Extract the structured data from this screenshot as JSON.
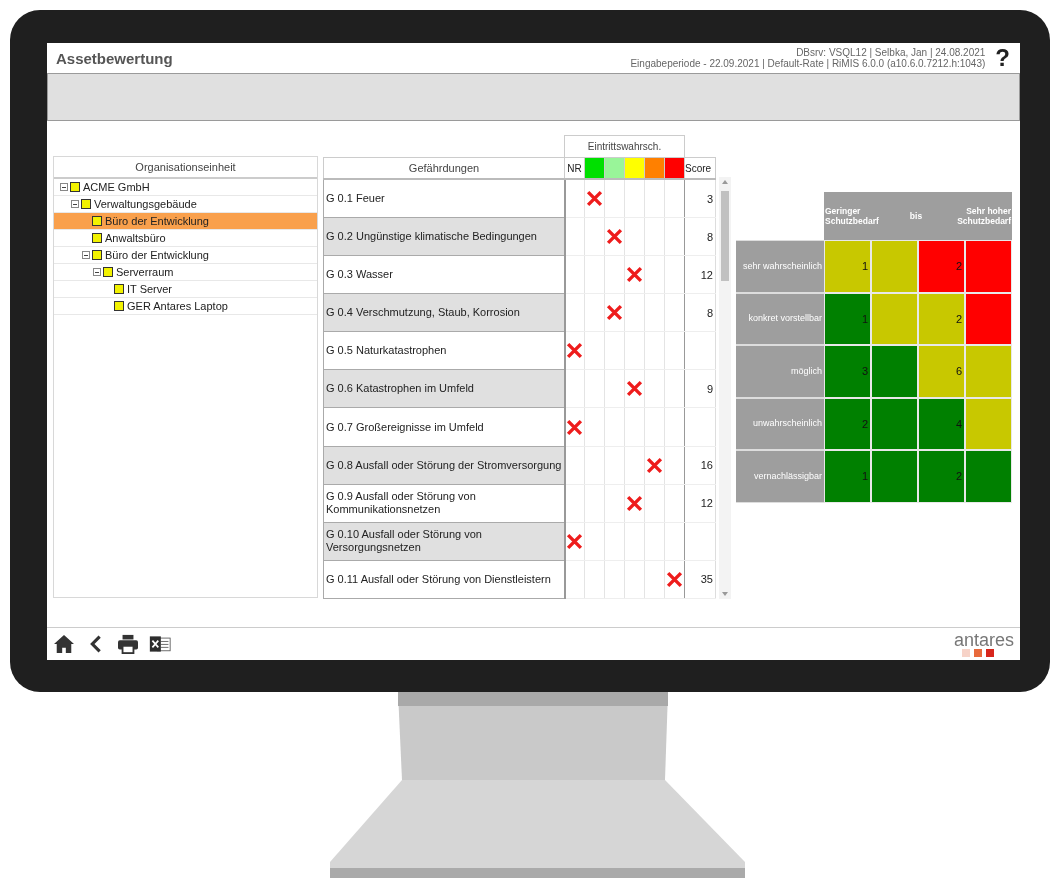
{
  "header": {
    "title": "Assetbewertung",
    "info_lines": [
      "DBsrv: VSQL12 | Selbka, Jan | 24.08.2021",
      "Eingabeperiode - 22.09.2021 | Default-Rate | RiMIS 6.0.0 (a10.6.0.7212.h:1043)"
    ],
    "help": "?"
  },
  "tree": {
    "heading": "Organisationseinheit",
    "nodes": [
      {
        "label": "ACME GmbH",
        "selected": false,
        "expanded": true,
        "children": [
          {
            "label": "Verwaltungsgebäude",
            "selected": false,
            "expanded": true,
            "children": [
              {
                "label": "Büro der Entwicklung",
                "selected": true
              },
              {
                "label": "Anwaltsbüro",
                "selected": false
              },
              {
                "label": "Büro der Entwicklung",
                "selected": false,
                "expanded": true,
                "children": [
                  {
                    "label": "Serverraum",
                    "selected": false,
                    "expanded": true,
                    "children": [
                      {
                        "label": "IT Server",
                        "selected": false
                      },
                      {
                        "label": "GER Antares Laptop",
                        "selected": false
                      }
                    ]
                  }
                ]
              }
            ]
          }
        ]
      }
    ]
  },
  "hazards": {
    "heading": "Gefährdungen",
    "likelihood_heading": "Eintrittswahrsch.",
    "score_heading": "Score",
    "likelihood_levels": [
      {
        "label": "NR"
      },
      {
        "color": "#00e000"
      },
      {
        "color": "#99f599"
      },
      {
        "color": "#ffff00"
      },
      {
        "color": "#ff8000"
      },
      {
        "color": "#ff0000"
      }
    ],
    "rows": [
      {
        "label": "G 0.1 Feuer",
        "crosses": [
          false,
          true,
          false,
          false,
          false,
          false
        ],
        "score": "3"
      },
      {
        "label": "G 0.2 Ungünstige klimatische Bedingungen",
        "crosses": [
          false,
          false,
          true,
          false,
          false,
          false
        ],
        "score": "8"
      },
      {
        "label": "G 0.3 Wasser",
        "crosses": [
          false,
          false,
          false,
          true,
          false,
          false
        ],
        "score": "12"
      },
      {
        "label": "G 0.4 Verschmutzung, Staub, Korrosion",
        "crosses": [
          false,
          false,
          true,
          false,
          false,
          false
        ],
        "score": "8"
      },
      {
        "label": "G 0.5 Naturkatastrophen",
        "crosses": [
          true,
          false,
          false,
          false,
          false,
          false
        ]
      },
      {
        "label": "G 0.6 Katastrophen im Umfeld",
        "crosses": [
          false,
          false,
          false,
          true,
          false,
          false
        ],
        "score": "9"
      },
      {
        "label": "G 0.7 Großereignisse im Umfeld",
        "crosses": [
          true,
          false,
          false,
          false,
          false,
          false
        ]
      },
      {
        "label": "G 0.8 Ausfall oder Störung der Stromversorgung",
        "crosses": [
          false,
          false,
          false,
          false,
          true,
          false
        ],
        "score": "16"
      },
      {
        "label": "G 0.9 Ausfall oder Störung von Kommunikationsnetzen",
        "crosses": [
          false,
          false,
          false,
          true,
          false,
          false
        ],
        "score": "12"
      },
      {
        "label": "G 0.10 Ausfall oder Störung von Versorgungsnetzen",
        "crosses": [
          true,
          false,
          false,
          false,
          false,
          false
        ]
      },
      {
        "label": "G 0.11 Ausfall oder Störung von Dienstleistern",
        "crosses": [
          false,
          false,
          false,
          false,
          false,
          true
        ],
        "score": "35"
      }
    ]
  },
  "risk_matrix": {
    "header": {
      "left": "Geringer Schutzbedarf",
      "middle": "bis",
      "right": "Sehr hoher Schutzbedarf"
    },
    "rows": [
      {
        "label": "sehr wahrscheinlich",
        "cells": [
          {
            "value": "1",
            "color": "#c8c800"
          },
          {
            "color": "#c8c800"
          },
          {
            "value": "2",
            "color": "#ff0000"
          },
          {
            "color": "#ff0000"
          }
        ]
      },
      {
        "label": "konkret vorstellbar",
        "cells": [
          {
            "value": "1",
            "color": "#008000"
          },
          {
            "color": "#c8c800"
          },
          {
            "value": "2",
            "color": "#c8c800"
          },
          {
            "color": "#ff0000"
          }
        ]
      },
      {
        "label": "möglich",
        "cells": [
          {
            "value": "3",
            "color": "#008000"
          },
          {
            "color": "#008000"
          },
          {
            "value": "6",
            "color": "#c8c800"
          },
          {
            "color": "#c8c800"
          }
        ]
      },
      {
        "label": "unwahrscheinlich",
        "cells": [
          {
            "value": "2",
            "color": "#008000"
          },
          {
            "color": "#008000"
          },
          {
            "value": "4",
            "color": "#008000"
          },
          {
            "color": "#c8c800"
          }
        ]
      },
      {
        "label": "vernachlässigbar",
        "cells": [
          {
            "value": "1",
            "color": "#008000"
          },
          {
            "color": "#008000"
          },
          {
            "value": "2",
            "color": "#008000"
          },
          {
            "color": "#008000"
          }
        ]
      }
    ]
  },
  "footer": {
    "logo": "antares"
  }
}
